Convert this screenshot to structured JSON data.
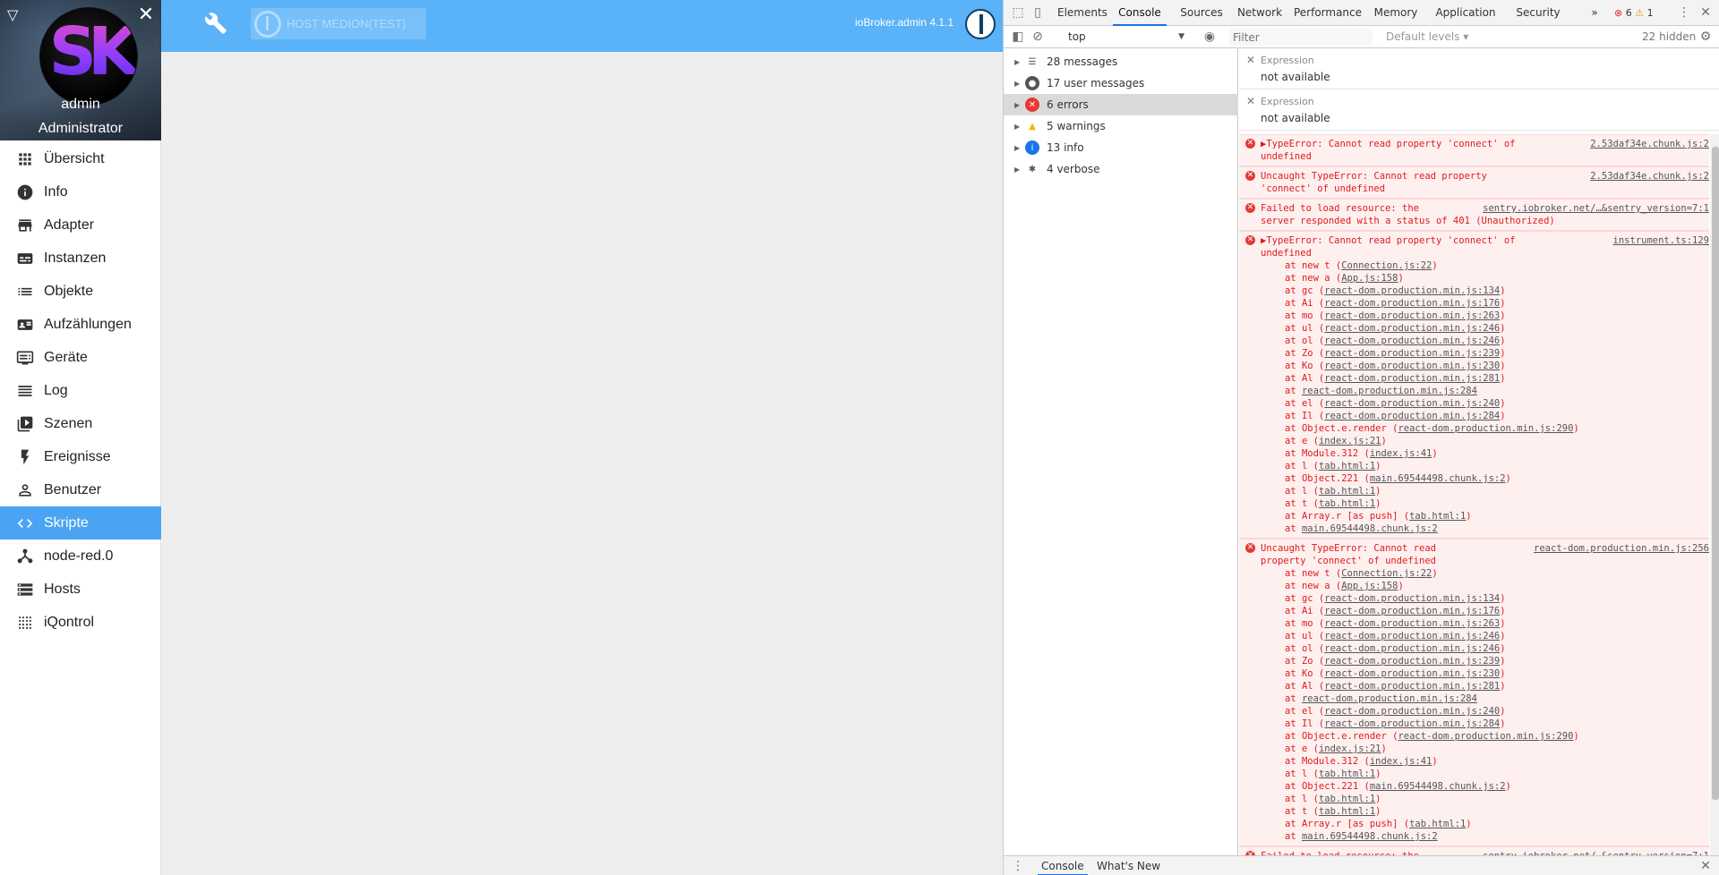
{
  "sidebar": {
    "user_name": "admin",
    "user_role": "Administrator",
    "items": [
      {
        "label": "Übersicht",
        "icon": "apps-icon"
      },
      {
        "label": "Info",
        "icon": "info-icon"
      },
      {
        "label": "Adapter",
        "icon": "store-icon"
      },
      {
        "label": "Instanzen",
        "icon": "instances-icon"
      },
      {
        "label": "Objekte",
        "icon": "list-icon"
      },
      {
        "label": "Aufzählungen",
        "icon": "enum-icon"
      },
      {
        "label": "Geräte",
        "icon": "devices-icon"
      },
      {
        "label": "Log",
        "icon": "log-icon"
      },
      {
        "label": "Szenen",
        "icon": "scenes-icon"
      },
      {
        "label": "Ereignisse",
        "icon": "flash-icon"
      },
      {
        "label": "Benutzer",
        "icon": "user-icon"
      },
      {
        "label": "Skripte",
        "icon": "code-icon"
      },
      {
        "label": "node-red.0",
        "icon": "node-red-icon"
      },
      {
        "label": "Hosts",
        "icon": "hosts-icon"
      },
      {
        "label": "iQontrol",
        "icon": "dots-grid-icon"
      }
    ],
    "active_index": 11,
    "accent_color": "#4aa4f3"
  },
  "appbar": {
    "host_label": "HOST MEDION(TEST)",
    "version": "ioBroker.admin 4.1.1",
    "color": "#5ab2f8"
  },
  "devtools": {
    "tabs": [
      "Elements",
      "Console",
      "Sources",
      "Network",
      "Performance",
      "Memory",
      "Application",
      "Security"
    ],
    "active_tab": "Console",
    "more": "»",
    "error_count": "6",
    "warning_count": "1",
    "context": "top",
    "filter_placeholder": "Filter",
    "levels": "Default levels ▾",
    "hidden": "22 hidden",
    "categories": [
      {
        "label": "28 messages",
        "icon": "list-icon"
      },
      {
        "label": "17 user messages",
        "icon": "user-icon"
      },
      {
        "label": "6 errors",
        "icon": "error-icon"
      },
      {
        "label": "5 warnings",
        "icon": "warning-icon"
      },
      {
        "label": "13 info",
        "icon": "info-icon"
      },
      {
        "label": "4 verbose",
        "icon": "bug-icon"
      }
    ],
    "expressions": [
      {
        "label": "Expression",
        "value": "not available"
      },
      {
        "label": "Expression",
        "value": "not available"
      }
    ],
    "messages": [
      {
        "text": [
          "▶TypeError: Cannot read property 'connect' of",
          "undefined"
        ],
        "source": "2.53daf34e.chunk.js:2",
        "frames": []
      },
      {
        "text": [
          "Uncaught TypeError: Cannot read property",
          "'connect' of undefined"
        ],
        "source": "2.53daf34e.chunk.js:2",
        "frames": []
      },
      {
        "text": [
          "Failed to load resource: the",
          "server responded with a status of 401 (Unauthorized)"
        ],
        "source": "sentry.iobroker.net/…&sentry_version=7:1",
        "frames": []
      },
      {
        "text": [
          "▶TypeError: Cannot read property 'connect' of",
          "undefined"
        ],
        "source": "instrument.ts:129",
        "frames": [
          [
            "at new t (",
            "Connection.js:22",
            ")"
          ],
          [
            "at new a (",
            "App.js:158",
            ")"
          ],
          [
            "at gc (",
            "react-dom.production.min.js:134",
            ")"
          ],
          [
            "at Ai (",
            "react-dom.production.min.js:176",
            ")"
          ],
          [
            "at mo (",
            "react-dom.production.min.js:263",
            ")"
          ],
          [
            "at ul (",
            "react-dom.production.min.js:246",
            ")"
          ],
          [
            "at ol (",
            "react-dom.production.min.js:246",
            ")"
          ],
          [
            "at Zo (",
            "react-dom.production.min.js:239",
            ")"
          ],
          [
            "at Ko (",
            "react-dom.production.min.js:230",
            ")"
          ],
          [
            "at Al (",
            "react-dom.production.min.js:281",
            ")"
          ],
          [
            "at ",
            "react-dom.production.min.js:284",
            ""
          ],
          [
            "at el (",
            "react-dom.production.min.js:240",
            ")"
          ],
          [
            "at Il (",
            "react-dom.production.min.js:284",
            ")"
          ],
          [
            "at Object.e.render (",
            "react-dom.production.min.js:290",
            ")"
          ],
          [
            "at e (",
            "index.js:21",
            ")"
          ],
          [
            "at Module.312 (",
            "index.js:41",
            ")"
          ],
          [
            "at l (",
            "tab.html:1",
            ")"
          ],
          [
            "at Object.221 (",
            "main.69544498.chunk.js:2",
            ")"
          ],
          [
            "at l (",
            "tab.html:1",
            ")"
          ],
          [
            "at t (",
            "tab.html:1",
            ")"
          ],
          [
            "at Array.r [as push] (",
            "tab.html:1",
            ")"
          ],
          [
            "at ",
            "main.69544498.chunk.js:2",
            ""
          ]
        ]
      },
      {
        "text": [
          "Uncaught TypeError: Cannot read",
          "property 'connect' of undefined"
        ],
        "source": "react-dom.production.min.js:256",
        "frames": [
          [
            "at new t (",
            "Connection.js:22",
            ")"
          ],
          [
            "at new a (",
            "App.js:158",
            ")"
          ],
          [
            "at gc (",
            "react-dom.production.min.js:134",
            ")"
          ],
          [
            "at Ai (",
            "react-dom.production.min.js:176",
            ")"
          ],
          [
            "at mo (",
            "react-dom.production.min.js:263",
            ")"
          ],
          [
            "at ul (",
            "react-dom.production.min.js:246",
            ")"
          ],
          [
            "at ol (",
            "react-dom.production.min.js:246",
            ")"
          ],
          [
            "at Zo (",
            "react-dom.production.min.js:239",
            ")"
          ],
          [
            "at Ko (",
            "react-dom.production.min.js:230",
            ")"
          ],
          [
            "at Al (",
            "react-dom.production.min.js:281",
            ")"
          ],
          [
            "at ",
            "react-dom.production.min.js:284",
            ""
          ],
          [
            "at el (",
            "react-dom.production.min.js:240",
            ")"
          ],
          [
            "at Il (",
            "react-dom.production.min.js:284",
            ")"
          ],
          [
            "at Object.e.render (",
            "react-dom.production.min.js:290",
            ")"
          ],
          [
            "at e (",
            "index.js:21",
            ")"
          ],
          [
            "at Module.312 (",
            "index.js:41",
            ")"
          ],
          [
            "at l (",
            "tab.html:1",
            ")"
          ],
          [
            "at Object.221 (",
            "main.69544498.chunk.js:2",
            ")"
          ],
          [
            "at l (",
            "tab.html:1",
            ")"
          ],
          [
            "at t (",
            "tab.html:1",
            ")"
          ],
          [
            "at Array.r [as push] (",
            "tab.html:1",
            ")"
          ],
          [
            "at ",
            "main.69544498.chunk.js:2",
            ""
          ]
        ]
      },
      {
        "text": [
          "Failed to load resource: the"
        ],
        "source": "sentry.iobroker.net/…&sentry_version=7:1",
        "frames": []
      }
    ],
    "drawer_tabs": [
      "Console",
      "What's New"
    ]
  }
}
